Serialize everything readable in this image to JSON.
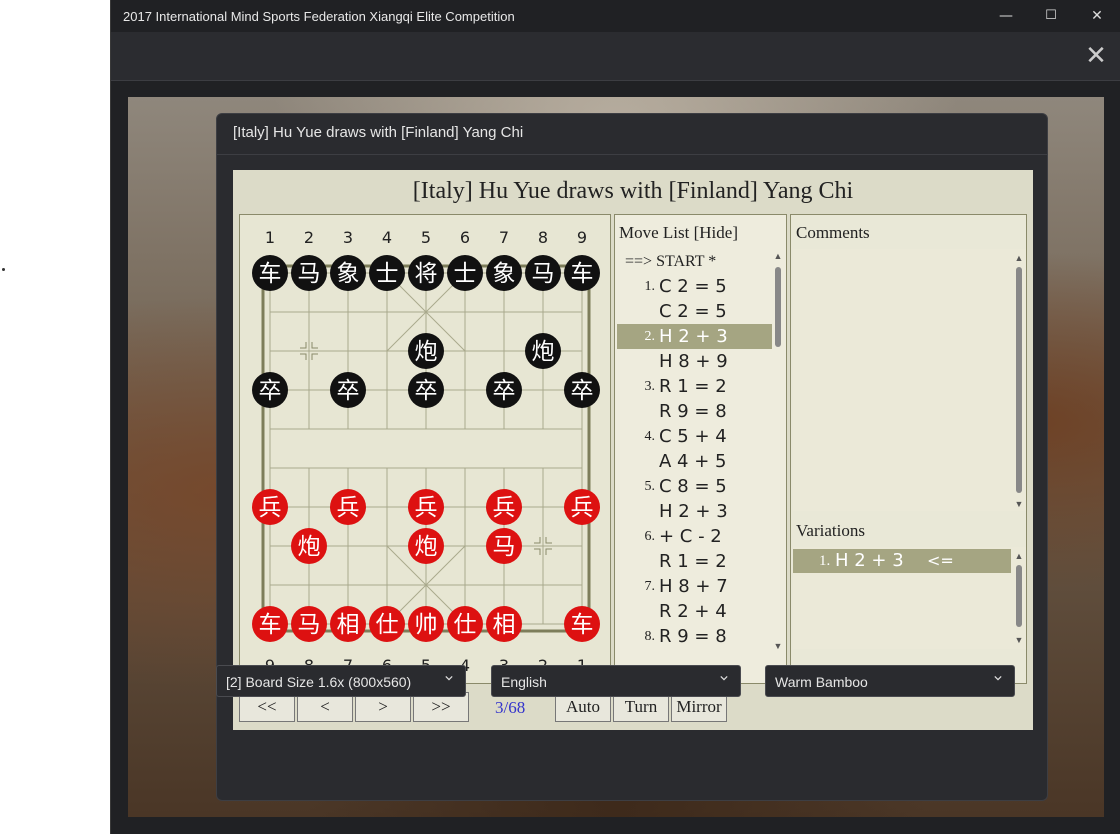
{
  "window": {
    "title": "2017 International Mind Sports Federation Xiangqi Elite Competition",
    "minimize": "—",
    "maximize": "☐",
    "close": "✕"
  },
  "toolbar": {
    "close": "✕"
  },
  "dialog": {
    "title": "[Italy] Hu Yue draws with [Finland] Yang Chi",
    "game_title": "[Italy] Hu Yue draws with [Finland] Yang Chi"
  },
  "board": {
    "top_files": [
      "1",
      "2",
      "3",
      "4",
      "5",
      "6",
      "7",
      "8",
      "9"
    ],
    "bottom_files": [
      "9",
      "8",
      "7",
      "6",
      "5",
      "4",
      "3",
      "2",
      "1"
    ],
    "black_pieces": [
      {
        "c": 0,
        "r": 0,
        "t": "车"
      },
      {
        "c": 1,
        "r": 0,
        "t": "马"
      },
      {
        "c": 2,
        "r": 0,
        "t": "象"
      },
      {
        "c": 3,
        "r": 0,
        "t": "士"
      },
      {
        "c": 4,
        "r": 0,
        "t": "将"
      },
      {
        "c": 5,
        "r": 0,
        "t": "士"
      },
      {
        "c": 6,
        "r": 0,
        "t": "象"
      },
      {
        "c": 7,
        "r": 0,
        "t": "马"
      },
      {
        "c": 8,
        "r": 0,
        "t": "车"
      },
      {
        "c": 4,
        "r": 2,
        "t": "炮"
      },
      {
        "c": 7,
        "r": 2,
        "t": "炮"
      },
      {
        "c": 0,
        "r": 3,
        "t": "卒"
      },
      {
        "c": 2,
        "r": 3,
        "t": "卒"
      },
      {
        "c": 4,
        "r": 3,
        "t": "卒"
      },
      {
        "c": 6,
        "r": 3,
        "t": "卒"
      },
      {
        "c": 8,
        "r": 3,
        "t": "卒"
      }
    ],
    "red_pieces": [
      {
        "c": 0,
        "r": 6,
        "t": "兵"
      },
      {
        "c": 2,
        "r": 6,
        "t": "兵"
      },
      {
        "c": 4,
        "r": 6,
        "t": "兵"
      },
      {
        "c": 6,
        "r": 6,
        "t": "兵"
      },
      {
        "c": 8,
        "r": 6,
        "t": "兵"
      },
      {
        "c": 1,
        "r": 7,
        "t": "炮"
      },
      {
        "c": 4,
        "r": 7,
        "t": "炮"
      },
      {
        "c": 6,
        "r": 7,
        "t": "马"
      },
      {
        "c": 0,
        "r": 9,
        "t": "车"
      },
      {
        "c": 1,
        "r": 9,
        "t": "马"
      },
      {
        "c": 2,
        "r": 9,
        "t": "相"
      },
      {
        "c": 3,
        "r": 9,
        "t": "仕"
      },
      {
        "c": 4,
        "r": 9,
        "t": "帅"
      },
      {
        "c": 5,
        "r": 9,
        "t": "仕"
      },
      {
        "c": 6,
        "r": 9,
        "t": "相"
      },
      {
        "c": 8,
        "r": 9,
        "t": "车"
      }
    ],
    "colors": {
      "black": "#111111",
      "red": "#dd1111",
      "line": "#a9a98c",
      "border": "#7d7d5a"
    }
  },
  "move_list": {
    "header": "Move List [Hide]",
    "items": [
      {
        "num": "",
        "move": "==> START *"
      },
      {
        "num": "1.",
        "move": "C 2 = 5"
      },
      {
        "num": "",
        "move": "C 2 = 5"
      },
      {
        "num": "2.",
        "move": "H 2 + 3",
        "selected": true
      },
      {
        "num": "",
        "move": "H 8 + 9"
      },
      {
        "num": "3.",
        "move": "R 1 = 2"
      },
      {
        "num": "",
        "move": "R 9 = 8"
      },
      {
        "num": "4.",
        "move": "C 5 + 4"
      },
      {
        "num": "",
        "move": "A 4 + 5"
      },
      {
        "num": "5.",
        "move": "C 8 = 5"
      },
      {
        "num": "",
        "move": "H 2 + 3"
      },
      {
        "num": "6.",
        "move": "+ C - 2"
      },
      {
        "num": "",
        "move": "R 1 = 2"
      },
      {
        "num": "7.",
        "move": "H 8 + 7"
      },
      {
        "num": "",
        "move": "R 2 + 4"
      },
      {
        "num": "8.",
        "move": "R 9 = 8"
      }
    ]
  },
  "comments": {
    "header": "Comments"
  },
  "variations": {
    "header": "Variations",
    "items": [
      {
        "num": "1.",
        "move": "H 2 + 3",
        "marker": "<="
      }
    ]
  },
  "controls": {
    "first": "<<",
    "prev": "<",
    "next": ">",
    "last": ">>",
    "counter": "3/68",
    "auto": "Auto",
    "turn": "Turn",
    "mirror": "Mirror"
  },
  "footer": {
    "board_size": "[2] Board Size 1.6x (800x560)",
    "language": "English",
    "theme": "Warm Bamboo"
  }
}
